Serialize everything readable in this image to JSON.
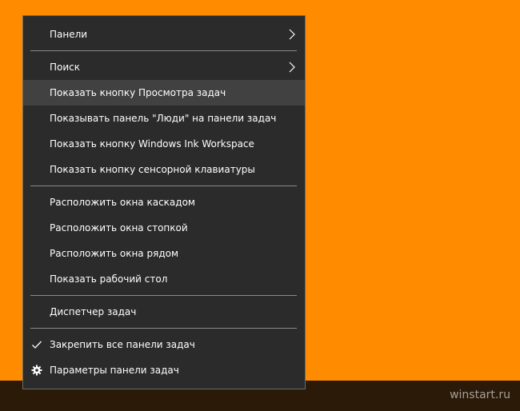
{
  "watermark": "winstart.ru",
  "colors": {
    "desktop": "#ff8c00",
    "menu_background": "#2b2b2b",
    "menu_hover": "#414141",
    "menu_text": "#ffffff",
    "taskbar": "#2b1a07"
  },
  "menu": {
    "items": [
      {
        "label": "Панели",
        "submenu": true
      },
      {
        "label": "Поиск",
        "submenu": true
      },
      {
        "label": "Показать кнопку Просмотра задач",
        "highlighted": true
      },
      {
        "label": "Показывать панель \"Люди\" на панели задач"
      },
      {
        "label": "Показать кнопку Windows Ink Workspace"
      },
      {
        "label": "Показать кнопку сенсорной клавиатуры"
      },
      {
        "label": "Расположить окна каскадом"
      },
      {
        "label": "Расположить окна стопкой"
      },
      {
        "label": "Расположить окна рядом"
      },
      {
        "label": "Показать рабочий стол"
      },
      {
        "label": "Диспетчер задач"
      },
      {
        "label": "Закрепить все панели задач",
        "icon": "checkmark-icon",
        "checked": true
      },
      {
        "label": "Параметры панели задач",
        "icon": "gear-icon"
      }
    ]
  }
}
